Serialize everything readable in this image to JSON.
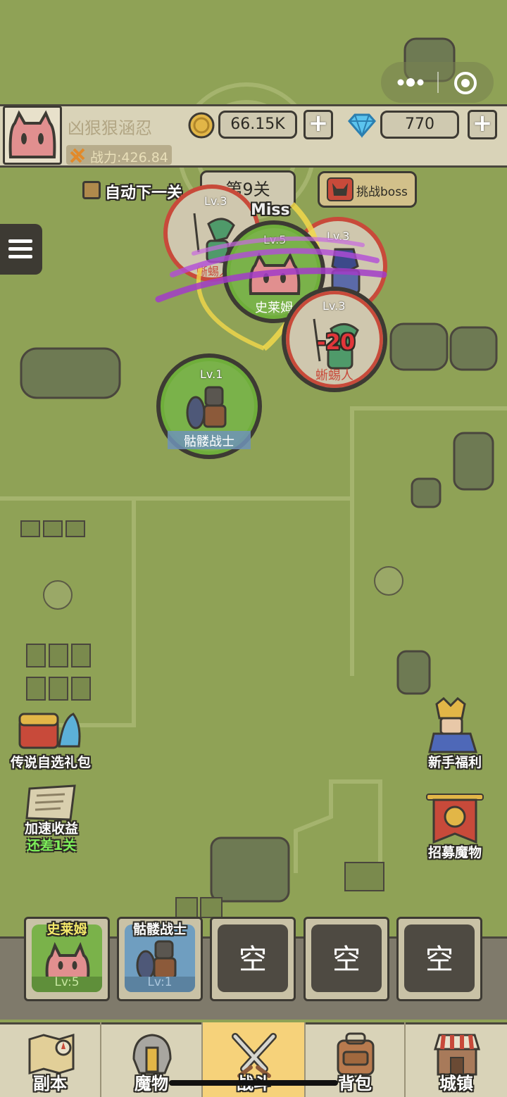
{
  "header": {
    "player_name": "凶狠狠涵忍",
    "power": "战力:426.84",
    "gold": "66.15K",
    "gems": "770",
    "plus": "+"
  },
  "stage": {
    "auto_next_label": "自动下一关",
    "stage_title": "第9关",
    "boss_button": "挑战boss",
    "miss_text": "Miss",
    "damage_text": "-20"
  },
  "battle_units": [
    {
      "level": "Lv.3",
      "name": "蜥蜴人",
      "side": "enemy"
    },
    {
      "level": "Lv.5",
      "name": "史莱姆",
      "side": "ally"
    },
    {
      "level": "Lv.3",
      "name": "",
      "side": "enemy"
    },
    {
      "level": "Lv.3",
      "name": "蜥蜴人",
      "side": "enemy"
    },
    {
      "level": "Lv.1",
      "name": "骷髅战士",
      "side": "ally"
    }
  ],
  "side_events": {
    "left": [
      {
        "label": "传说自选礼包",
        "icon": "treasure-chest-icon"
      },
      {
        "label": "加速收益",
        "sub": "还差1关",
        "icon": "scroll-icon"
      }
    ],
    "right": [
      {
        "label": "新手福利",
        "icon": "knight-icon"
      },
      {
        "label": "招募魔物",
        "icon": "banner-icon"
      }
    ]
  },
  "squad": [
    {
      "name": "史莱姆",
      "level": "Lv:5"
    },
    {
      "name": "骷髅战士",
      "level": "Lv:1"
    },
    {
      "empty": "空"
    },
    {
      "empty": "空"
    },
    {
      "empty": "空"
    }
  ],
  "nav": [
    {
      "label": "副本",
      "icon": "map-icon"
    },
    {
      "label": "魔物",
      "icon": "helmet-icon"
    },
    {
      "label": "战斗",
      "icon": "crossed-swords-icon",
      "active": true
    },
    {
      "label": "背包",
      "icon": "backpack-icon"
    },
    {
      "label": "城镇",
      "icon": "shop-icon"
    }
  ],
  "colors": {
    "grass": "#8fa256",
    "panel": "#d9d3b8",
    "dark": "#3d3a33",
    "nav_active": "#f6d27a",
    "ally_ring": "#6fae3b",
    "enemy_ring": "#c84a3a",
    "slime": "#e18f8f"
  }
}
